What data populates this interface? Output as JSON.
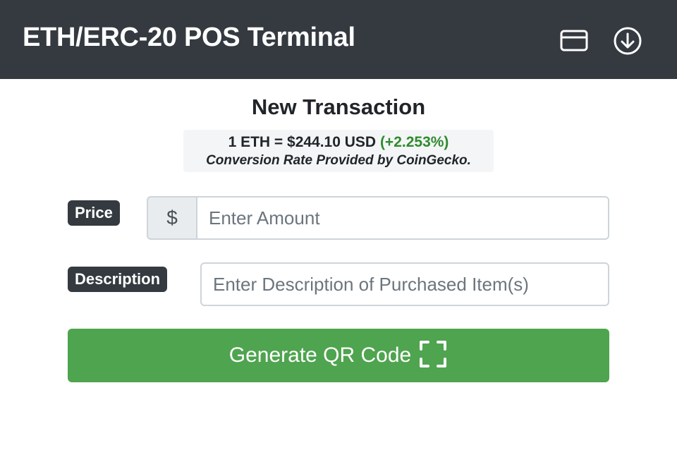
{
  "navbar": {
    "title": "ETH/ERC-20 POS Terminal",
    "icons": [
      "credit-card-icon",
      "download-circle-icon"
    ]
  },
  "main": {
    "heading": "New Transaction",
    "rate": {
      "text": "1 ETH = $244.10 USD",
      "change": "(+2.253%)",
      "change_color": "#2e8b2e",
      "credit": "Conversion Rate Provided by CoinGecko."
    },
    "price": {
      "label": "Price",
      "prefix": "$",
      "placeholder": "Enter Amount",
      "value": ""
    },
    "description": {
      "label": "Description",
      "placeholder": "Enter Description of Purchased Item(s)",
      "value": ""
    },
    "generate_button": {
      "label": "Generate QR Code",
      "icon": "qr-scan-icon",
      "color": "#4fa44f"
    }
  },
  "colors": {
    "navbar_bg": "#343a40",
    "badge_bg": "#343a40",
    "accent_green": "#4fa44f"
  }
}
